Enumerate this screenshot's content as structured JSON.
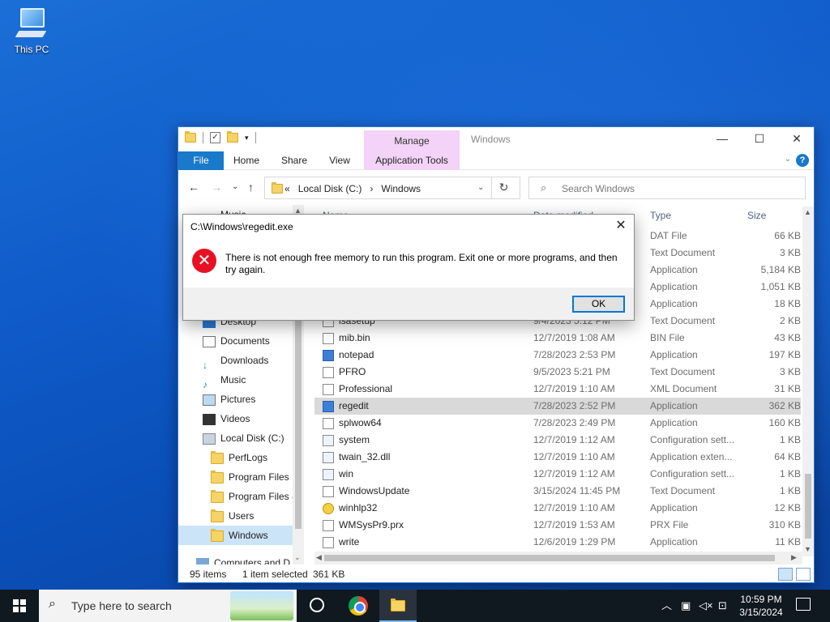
{
  "desktop": {
    "icon_label": "This PC"
  },
  "explorer": {
    "title": "Windows",
    "manage_tab": "Manage",
    "ribbon_tabs": [
      "File",
      "Home",
      "Share",
      "View",
      "Application Tools"
    ],
    "address": {
      "chevron": "«",
      "crumbs": [
        "Local Disk (C:)",
        "Windows"
      ]
    },
    "search_placeholder": "Search Windows",
    "nav": [
      "Music",
      "Desktop",
      "Documents",
      "Downloads",
      "Music",
      "Pictures",
      "Videos",
      "Local Disk (C:)",
      "PerfLogs",
      "Program Files",
      "Program Files (",
      "Users",
      "Windows",
      "Computers and D"
    ],
    "columns": {
      "name": "Name",
      "date": "Date modified",
      "type": "Type",
      "size": "Size"
    },
    "files": [
      {
        "name": "",
        "date": "",
        "type": "DAT File",
        "size": "66 KB"
      },
      {
        "name": "",
        "date": "",
        "type": "Text Document",
        "size": "3 KB"
      },
      {
        "name": "",
        "date": "",
        "type": "Application",
        "size": "5,184 KB"
      },
      {
        "name": "",
        "date": "",
        "type": "Application",
        "size": "1,051 KB"
      },
      {
        "name": "",
        "date": "",
        "type": "Application",
        "size": "18 KB"
      },
      {
        "name": "lsasetup",
        "date": "9/4/2023 5:12 PM",
        "type": "Text Document",
        "size": "2 KB"
      },
      {
        "name": "mib.bin",
        "date": "12/7/2019 1:08 AM",
        "type": "BIN File",
        "size": "43 KB"
      },
      {
        "name": "notepad",
        "date": "7/28/2023 2:53 PM",
        "type": "Application",
        "size": "197 KB"
      },
      {
        "name": "PFRO",
        "date": "9/5/2023 5:21 PM",
        "type": "Text Document",
        "size": "3 KB"
      },
      {
        "name": "Professional",
        "date": "12/7/2019 1:10 AM",
        "type": "XML Document",
        "size": "31 KB"
      },
      {
        "name": "regedit",
        "date": "7/28/2023 2:52 PM",
        "type": "Application",
        "size": "362 KB"
      },
      {
        "name": "splwow64",
        "date": "7/28/2023 2:49 PM",
        "type": "Application",
        "size": "160 KB"
      },
      {
        "name": "system",
        "date": "12/7/2019 1:12 AM",
        "type": "Configuration sett...",
        "size": "1 KB"
      },
      {
        "name": "twain_32.dll",
        "date": "12/7/2019 1:10 AM",
        "type": "Application exten...",
        "size": "64 KB"
      },
      {
        "name": "win",
        "date": "12/7/2019 1:12 AM",
        "type": "Configuration sett...",
        "size": "1 KB"
      },
      {
        "name": "WindowsUpdate",
        "date": "3/15/2024 11:45 PM",
        "type": "Text Document",
        "size": "1 KB"
      },
      {
        "name": "winhlp32",
        "date": "12/7/2019 1:10 AM",
        "type": "Application",
        "size": "12 KB"
      },
      {
        "name": "WMSysPr9.prx",
        "date": "12/7/2019 1:53 AM",
        "type": "PRX File",
        "size": "310 KB"
      },
      {
        "name": "write",
        "date": "12/6/2019 1:29 PM",
        "type": "Application",
        "size": "11 KB"
      }
    ],
    "status": {
      "items": "95 items",
      "selected": "1 item selected",
      "size": "361 KB"
    }
  },
  "dialog": {
    "title": "C:\\Windows\\regedit.exe",
    "message": "There is not enough free memory to run this program. Exit one or more programs, and then try again.",
    "ok_label": "OK"
  },
  "taskbar": {
    "search_placeholder": "Type here to search",
    "time": "10:59 PM",
    "date": "3/15/2024"
  }
}
